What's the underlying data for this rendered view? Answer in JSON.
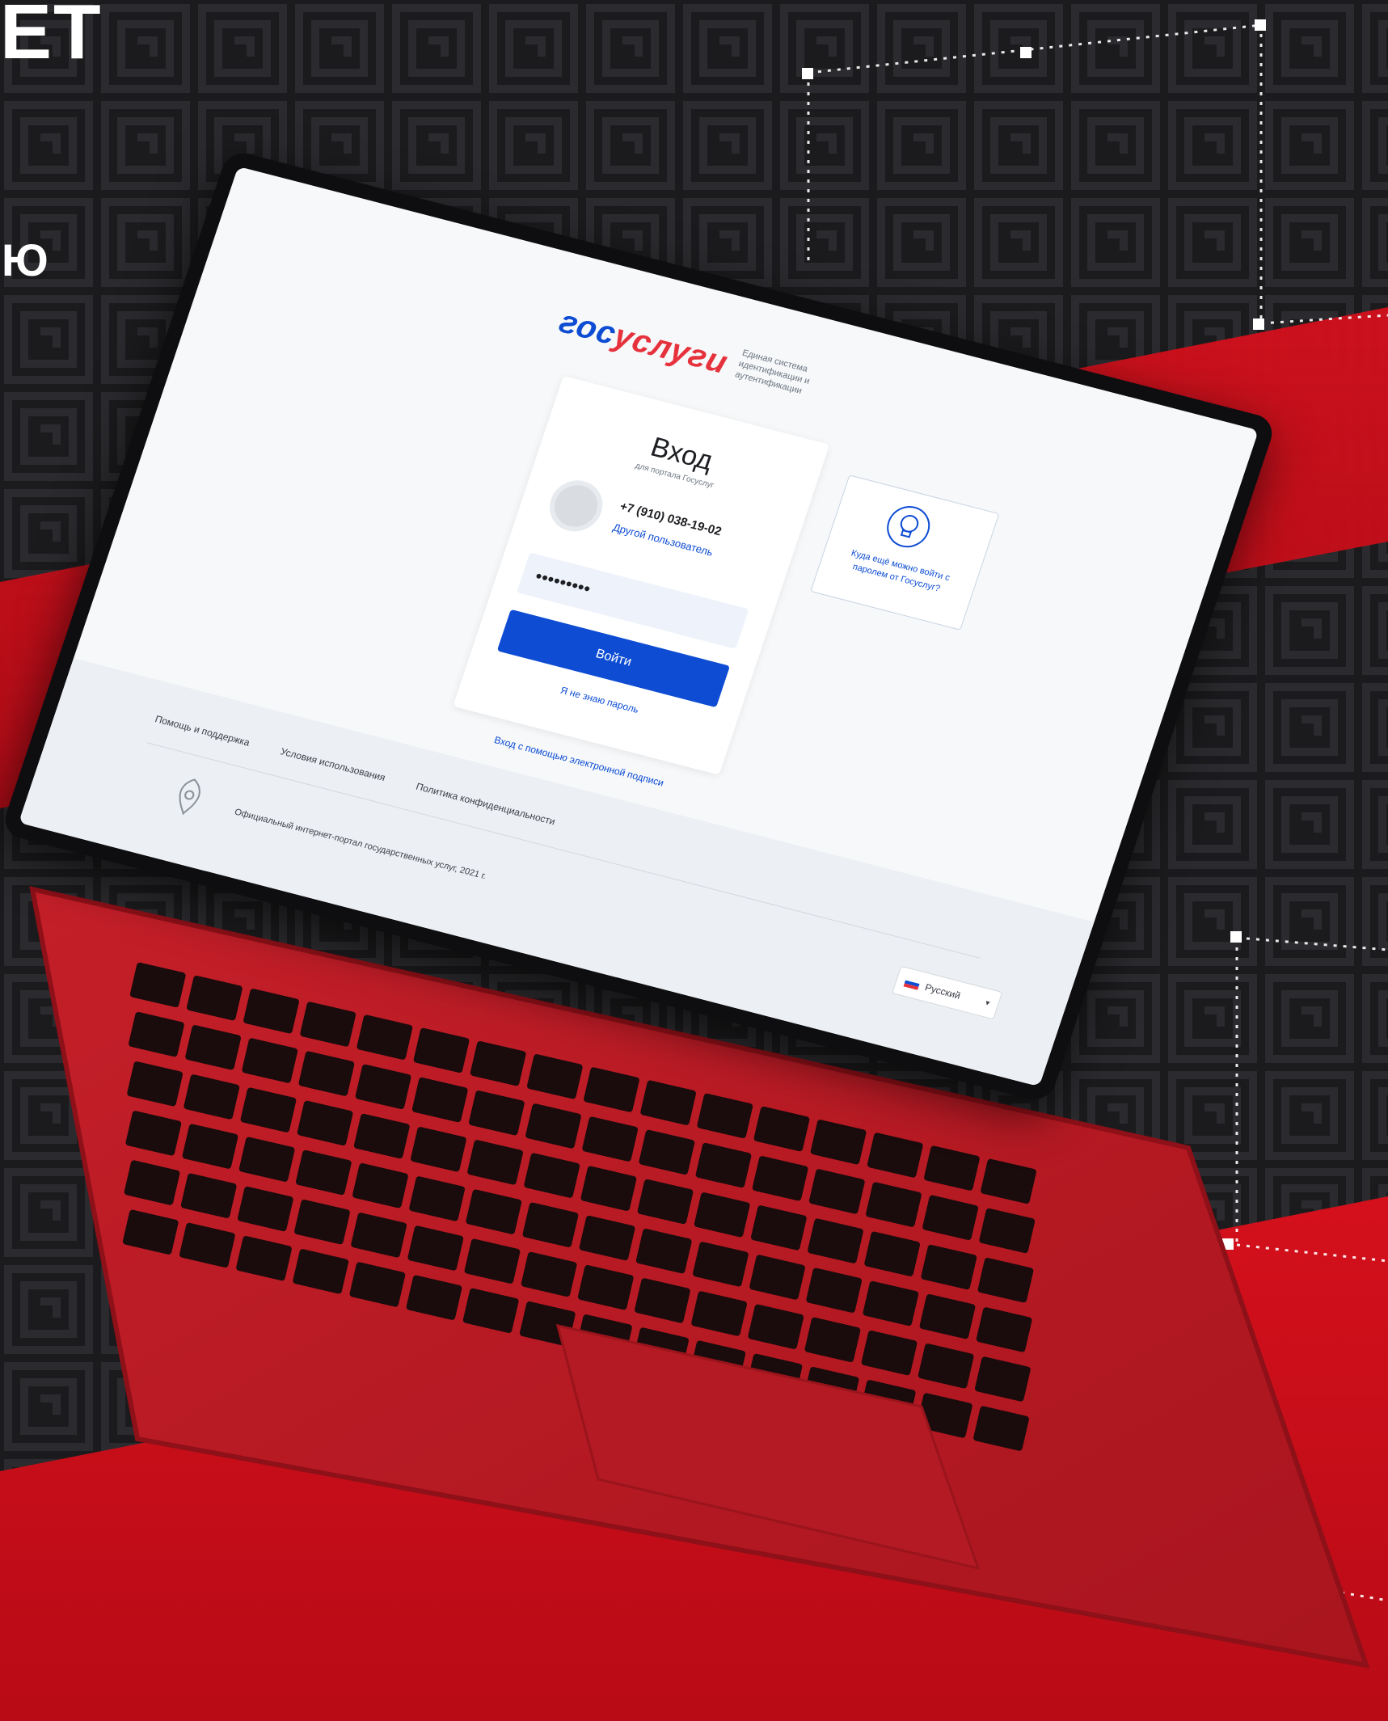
{
  "headline": {
    "line1": "ЕТ",
    "line2": "Ю"
  },
  "colors": {
    "brand_blue": "#0d4cd3",
    "brand_red": "#e6323c",
    "laptop_red": "#c8202a",
    "background_red": "#d4101c",
    "background_dark": "#1b1b1d"
  },
  "gosuslugi": {
    "logo_part1": "гос",
    "logo_part2": "услуги",
    "logo_subtitle": "Единая система идентификации и аутентификации",
    "login": {
      "title": "Вход",
      "subtitle": "для портала Госуслуг",
      "phone": "+7 (910) 038-19-02",
      "other_user": "Другой пользователь",
      "password_value": "•••••••••",
      "login_button": "Войти",
      "forgot": "Я не знаю пароль"
    },
    "ep_link": "Вход с помощью электронной подписи",
    "side_card": {
      "text": "Куда ещё можно войти с паролем от Госуслуг?",
      "icon": "lightbulb-icon"
    },
    "footer": {
      "links": [
        "Помощь и поддержка",
        "Условия использования",
        "Политика конфиденциальности"
      ],
      "copyright": "Официальный интернет-портал государственных услуг, 2021 г.",
      "emblem_icon": "coat-of-arms-icon",
      "language": "Русский"
    }
  }
}
